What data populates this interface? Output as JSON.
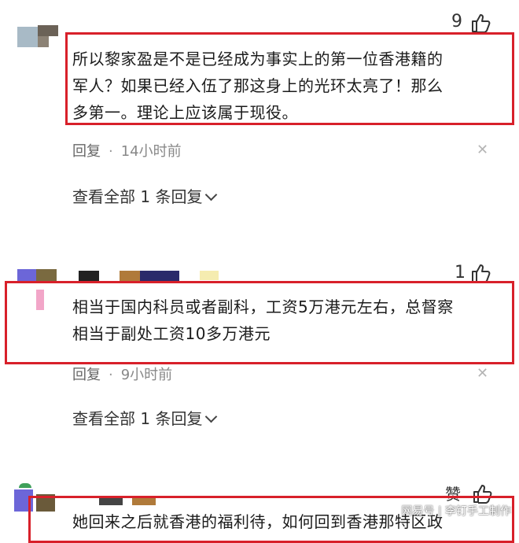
{
  "comments": [
    {
      "likes": "9",
      "text_lines": [
        "所以黎家盈是不是已经成为事实上的第一位香港籍的",
        "军人？如果已经入伍了那这身上的光环太亮了！那么",
        "多第一。理论上应该属于现役。"
      ],
      "reply_label": "回复",
      "time": "14小时前",
      "view_replies": "查看全部 1 条回复"
    },
    {
      "likes": "1",
      "text_lines": [
        "相当于国内科员或者副科，工资5万港元左右，总督察",
        "相当于副处工资10多万港元"
      ],
      "reply_label": "回复",
      "time": "9小时前",
      "view_replies": "查看全部 1 条回复"
    },
    {
      "likes": "赞",
      "text_lines": [
        "她回来之后就香港的福利待，如何回到香港那特区政"
      ]
    }
  ],
  "watermark": "网易号 | 李钉手工制作",
  "colors": {
    "highlight": "#d8202a"
  }
}
